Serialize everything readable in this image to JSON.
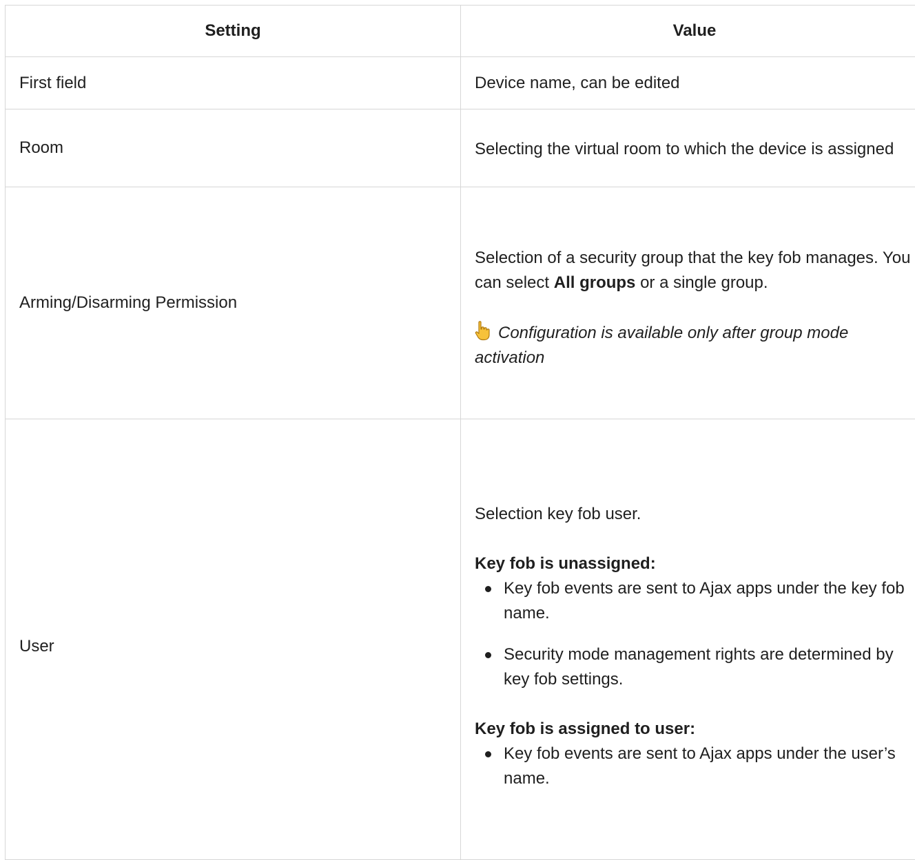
{
  "table": {
    "headers": {
      "setting": "Setting",
      "value": "Value"
    },
    "rows": [
      {
        "setting": "First field",
        "value": "Device name, can be edited"
      },
      {
        "setting": "Room",
        "value": "Selecting the virtual room to which the device is assigned"
      },
      {
        "setting": "Arming/Disarming Permission",
        "value_pre": "Selection of a security group that the key fob manages. You can select ",
        "value_bold": "All groups",
        "value_post": " or a single group.",
        "note_icon": "pointing-hand-icon",
        "note": "Configuration is available only after group mode activation"
      },
      {
        "setting": "User",
        "intro": "Selection key fob user.",
        "unassigned_heading": "Key fob is unassigned:",
        "unassigned_items": [
          "Key fob events are sent to Ajax apps under the key fob name.",
          "Security mode management rights are determined by key fob settings."
        ],
        "assigned_heading": "Key fob is assigned to user:",
        "assigned_items": [
          "Key fob events are sent to Ajax apps under the user’s name."
        ]
      }
    ]
  }
}
